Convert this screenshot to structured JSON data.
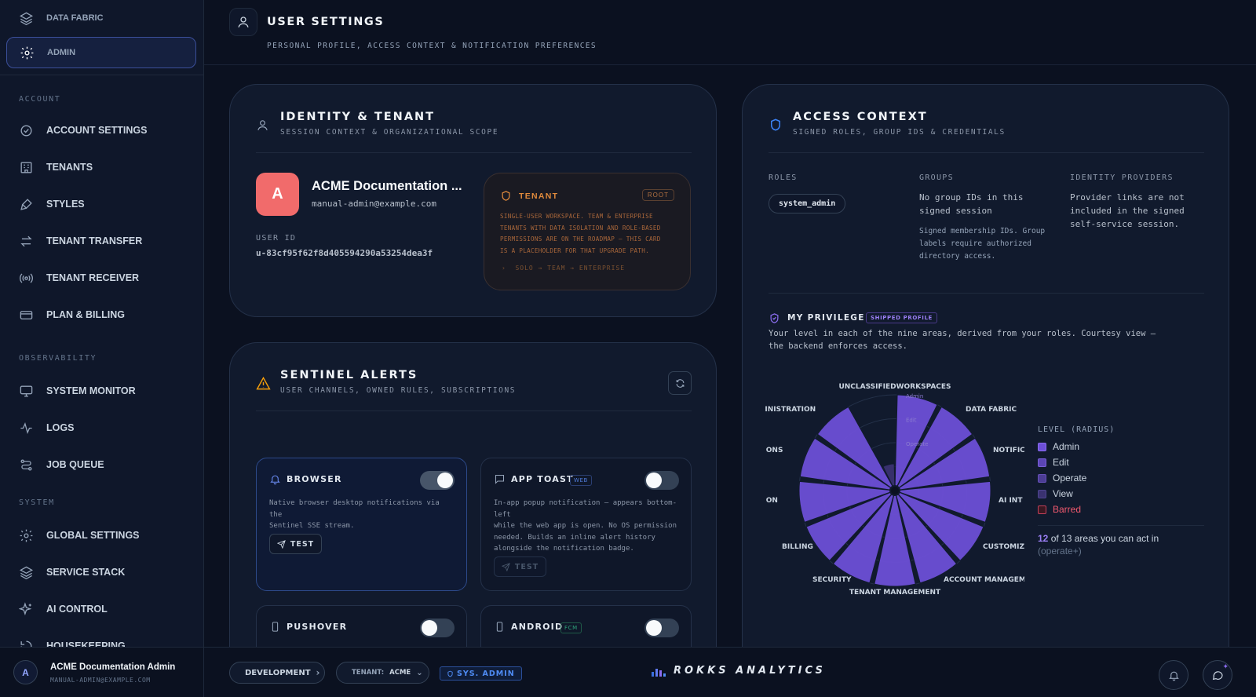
{
  "sidebar": {
    "top_items": [
      {
        "label": "DATA FABRIC",
        "icon": "layers-icon"
      },
      {
        "label": "ADMIN",
        "icon": "gear-icon",
        "active": true
      }
    ],
    "sections": {
      "account": "ACCOUNT",
      "observability": "OBSERVABILITY",
      "system": "SYSTEM"
    },
    "account_items": [
      "ACCOUNT SETTINGS",
      "TENANTS",
      "STYLES",
      "TENANT TRANSFER",
      "TENANT RECEIVER",
      "PLAN & BILLING"
    ],
    "observability_items": [
      "SYSTEM MONITOR",
      "LOGS",
      "JOB QUEUE"
    ],
    "system_items": [
      "GLOBAL SETTINGS",
      "SERVICE STACK",
      "AI CONTROL",
      "HOUSEKEEPING"
    ],
    "user": {
      "initial": "A",
      "name": "ACME Documentation Admin",
      "email": "MANUAL-ADMIN@EXAMPLE.COM"
    }
  },
  "header": {
    "title": "USER SETTINGS",
    "subtitle": "PERSONAL PROFILE, ACCESS CONTEXT & NOTIFICATION PREFERENCES"
  },
  "identity": {
    "title": "IDENTITY & TENANT",
    "subtitle": "SESSION CONTEXT & ORGANIZATIONAL SCOPE",
    "avatar_initial": "A",
    "name": "ACME Documentation ...",
    "email": "manual-admin@example.com",
    "user_id_label": "USER ID",
    "user_id": "u-83cf95f62f8d405594290a53254dea3f",
    "tenant": {
      "title": "TENANT",
      "badge": "ROOT",
      "lines": [
        "SINGLE-USER WORKSPACE. TEAM & ENTERPRISE",
        "TENANTS WITH DATA ISOLATION AND ROLE-BASED",
        "PERMISSIONS ARE ON THE ROADMAP — THIS CARD",
        "IS A PLACEHOLDER FOR THAT UPGRADE PATH."
      ],
      "path": "SOLO → TEAM → ENTERPRISE"
    }
  },
  "sentinel": {
    "title": "SENTINEL ALERTS",
    "subtitle": "USER CHANNELS, OWNED RULES, SUBSCRIPTIONS",
    "channels": [
      {
        "title": "BROWSER",
        "enabled": true,
        "lines": [
          "Native browser desktop notifications via the",
          "Sentinel SSE stream."
        ],
        "test": "TEST"
      },
      {
        "title": "APP TOAST",
        "badge": "WEB",
        "enabled": false,
        "lines": [
          "In-app popup notification — appears bottom-left",
          "while the web app is open. No OS permission",
          "needed. Builds an inline alert history",
          "alongside the notification badge."
        ],
        "test": "TEST"
      },
      {
        "title": "PUSHOVER",
        "enabled": false
      },
      {
        "title": "ANDROID",
        "badge": "FCM",
        "enabled": false
      }
    ]
  },
  "access": {
    "title": "ACCESS CONTEXT",
    "subtitle": "SIGNED ROLES, GROUP IDS & CREDENTIALS",
    "roles_label": "ROLES",
    "role": "system_admin",
    "groups_label": "GROUPS",
    "groups_text": [
      "No group IDs in this",
      "signed session"
    ],
    "groups_note": [
      "Signed membership IDs. Group",
      "labels require authorized",
      "directory access."
    ],
    "idp_label": "IDENTITY PROVIDERS",
    "idp_text": [
      "Provider links are not",
      "included in the signed",
      "self-service session."
    ],
    "privilege": {
      "title": "MY PRIVILEGE",
      "badge": "SHIPPED PROFILE",
      "desc": [
        "Your level in each of the nine areas, derived from your roles. Courtesy view —",
        "the backend enforces access."
      ],
      "legend_title": "LEVEL (RADIUS)",
      "legend": [
        {
          "label": "Admin",
          "color": "#6d4fd6"
        },
        {
          "label": "Edit",
          "color": "#5b45b5"
        },
        {
          "label": "Operate",
          "color": "#4c3d94"
        },
        {
          "label": "View",
          "color": "#3a3270"
        },
        {
          "label": "Barred",
          "color": "#7a2738",
          "text_color": "#f0596e"
        }
      ],
      "count": "12",
      "count_text": "of 13 areas you can act in",
      "count_sub": "(operate+)",
      "tick_labels": [
        "Admin",
        "Edit",
        "Operate"
      ],
      "axes": [
        {
          "label": "UNCLASSIFIEDWORKSPACES",
          "level": "Admin"
        },
        {
          "label": "DATA FABRIC",
          "level": "Admin"
        },
        {
          "label": "NOTIFIC",
          "level": "Admin"
        },
        {
          "label": "AI INT",
          "level": "Admin"
        },
        {
          "label": "CUSTOMIZ",
          "level": "Admin"
        },
        {
          "label": "ACCOUNT MANAGEMI",
          "level": "Admin"
        },
        {
          "label": "TENANT MANAGEMENT",
          "level": "Admin"
        },
        {
          "label": "SECURITY",
          "level": "Admin"
        },
        {
          "label": "BILLING",
          "level": "Admin"
        },
        {
          "label": "ATION",
          "level": "Admin"
        },
        {
          "label": "ATIONS",
          "level": "Admin"
        },
        {
          "label": "DMINISTRATION",
          "level": "Admin"
        },
        {
          "label": "",
          "level": "View"
        }
      ]
    }
  },
  "bottombar": {
    "env": "DEVELOPMENT",
    "tenant_label": "TENANT:",
    "tenant": "ACME",
    "role_badge": "SYS. ADMIN",
    "brand": "ROKKS ANALYTICS"
  },
  "colors": {
    "accent": "#6d4fd6",
    "active_nav": "#3b4f9a",
    "tenant_orange": "#e08a3c",
    "avatar_red": "#f16b6b"
  }
}
